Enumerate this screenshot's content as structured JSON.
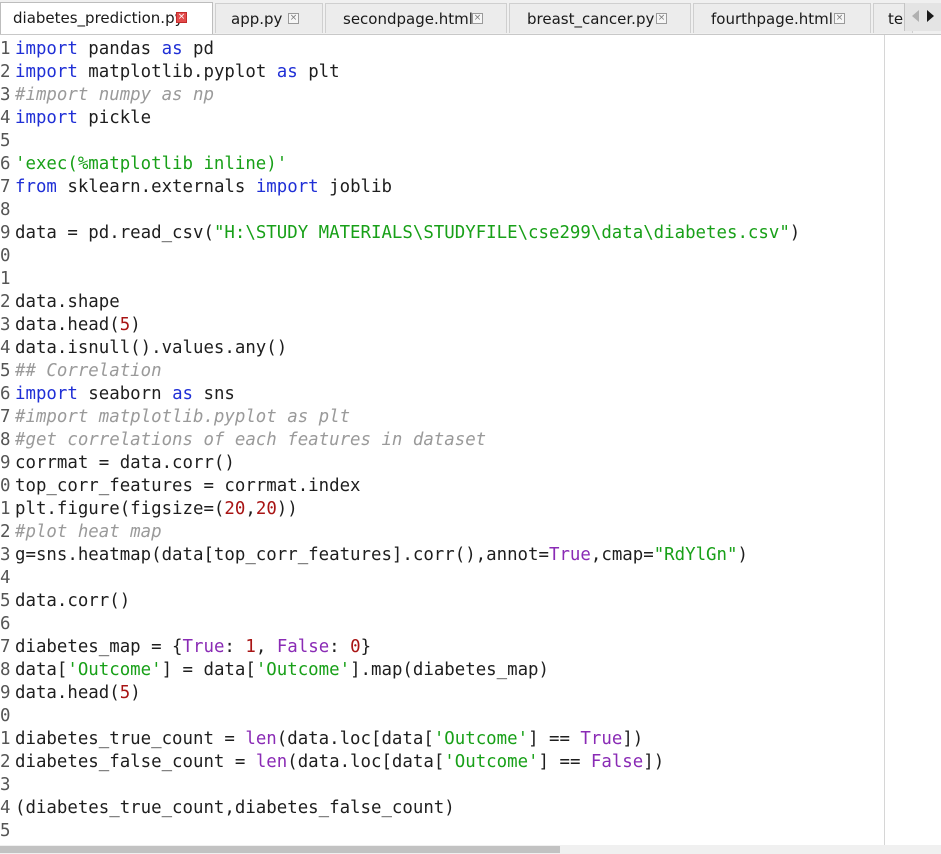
{
  "tabs": [
    {
      "label": "diabetes_prediction.py",
      "active": true
    },
    {
      "label": "app.py",
      "active": false
    },
    {
      "label": "secondpage.html",
      "active": false
    },
    {
      "label": "breast_cancer.py",
      "active": false
    },
    {
      "label": "fourthpage.html",
      "active": false
    },
    {
      "label": "te",
      "active": false
    }
  ],
  "close_glyph": "×",
  "code_lines": [
    {
      "n": "1",
      "t": [
        [
          "kw",
          "import"
        ],
        [
          "p",
          " pandas "
        ],
        [
          "kw",
          "as"
        ],
        [
          "p",
          " pd"
        ]
      ]
    },
    {
      "n": "2",
      "t": [
        [
          "kw",
          "import"
        ],
        [
          "p",
          " matplotlib.pyplot "
        ],
        [
          "kw",
          "as"
        ],
        [
          "p",
          " plt"
        ]
      ]
    },
    {
      "n": "3",
      "t": [
        [
          "cm",
          "#import numpy as np"
        ]
      ]
    },
    {
      "n": "4",
      "t": [
        [
          "kw",
          "import"
        ],
        [
          "p",
          " pickle"
        ]
      ]
    },
    {
      "n": "5",
      "t": []
    },
    {
      "n": "6",
      "t": [
        [
          "st",
          "'exec(%matplotlib inline)'"
        ]
      ]
    },
    {
      "n": "7",
      "t": [
        [
          "kw",
          "from"
        ],
        [
          "p",
          " sklearn.externals "
        ],
        [
          "kw",
          "import"
        ],
        [
          "p",
          " joblib"
        ]
      ]
    },
    {
      "n": "8",
      "t": []
    },
    {
      "n": "9",
      "t": [
        [
          "p",
          "data = pd.read_csv("
        ],
        [
          "st",
          "\"H:\\STUDY MATERIALS\\STUDYFILE\\cse299\\data\\diabetes.csv\""
        ],
        [
          "p",
          ")"
        ]
      ]
    },
    {
      "n": "0",
      "t": []
    },
    {
      "n": "1",
      "t": []
    },
    {
      "n": "2",
      "t": [
        [
          "p",
          "data.shape"
        ]
      ]
    },
    {
      "n": "3",
      "t": [
        [
          "p",
          "data.head("
        ],
        [
          "nm",
          "5"
        ],
        [
          "p",
          ")"
        ]
      ]
    },
    {
      "n": "4",
      "t": [
        [
          "p",
          "data.isnull().values.any()"
        ]
      ]
    },
    {
      "n": "5",
      "t": [
        [
          "cm",
          "## Correlation"
        ]
      ]
    },
    {
      "n": "6",
      "t": [
        [
          "kw",
          "import"
        ],
        [
          "p",
          " seaborn "
        ],
        [
          "kw",
          "as"
        ],
        [
          "p",
          " sns"
        ]
      ]
    },
    {
      "n": "7",
      "t": [
        [
          "cm",
          "#import matplotlib.pyplot as plt"
        ]
      ]
    },
    {
      "n": "8",
      "t": [
        [
          "cm",
          "#get correlations of each features in dataset"
        ]
      ]
    },
    {
      "n": "9",
      "t": [
        [
          "p",
          "corrmat = data.corr()"
        ]
      ]
    },
    {
      "n": "0",
      "t": [
        [
          "p",
          "top_corr_features = corrmat.index"
        ]
      ]
    },
    {
      "n": "1",
      "t": [
        [
          "p",
          "plt.figure(figsize=("
        ],
        [
          "nm",
          "20"
        ],
        [
          "p",
          ","
        ],
        [
          "nm",
          "20"
        ],
        [
          "p",
          "))"
        ]
      ]
    },
    {
      "n": "2",
      "t": [
        [
          "cm",
          "#plot heat map"
        ]
      ]
    },
    {
      "n": "3",
      "t": [
        [
          "p",
          "g=sns.heatmap(data[top_corr_features].corr(),annot="
        ],
        [
          "bi",
          "True"
        ],
        [
          "p",
          ",cmap="
        ],
        [
          "st",
          "\"RdYlGn\""
        ],
        [
          "p",
          ")"
        ]
      ]
    },
    {
      "n": "4",
      "t": []
    },
    {
      "n": "5",
      "t": [
        [
          "p",
          "data.corr()"
        ]
      ]
    },
    {
      "n": "6",
      "t": []
    },
    {
      "n": "7",
      "t": [
        [
          "p",
          "diabetes_map = {"
        ],
        [
          "bi",
          "True"
        ],
        [
          "p",
          ": "
        ],
        [
          "nm",
          "1"
        ],
        [
          "p",
          ", "
        ],
        [
          "bi",
          "False"
        ],
        [
          "p",
          ": "
        ],
        [
          "nm",
          "0"
        ],
        [
          "p",
          "}"
        ]
      ]
    },
    {
      "n": "8",
      "t": [
        [
          "p",
          "data["
        ],
        [
          "st",
          "'Outcome'"
        ],
        [
          "p",
          "] = data["
        ],
        [
          "st",
          "'Outcome'"
        ],
        [
          "p",
          "].map(diabetes_map)"
        ]
      ]
    },
    {
      "n": "9",
      "t": [
        [
          "p",
          "data.head("
        ],
        [
          "nm",
          "5"
        ],
        [
          "p",
          ")"
        ]
      ]
    },
    {
      "n": "0",
      "t": []
    },
    {
      "n": "1",
      "t": [
        [
          "p",
          "diabetes_true_count = "
        ],
        [
          "bi",
          "len"
        ],
        [
          "p",
          "(data.loc[data["
        ],
        [
          "st",
          "'Outcome'"
        ],
        [
          "p",
          "] == "
        ],
        [
          "bi",
          "True"
        ],
        [
          "p",
          "])"
        ]
      ]
    },
    {
      "n": "2",
      "t": [
        [
          "p",
          "diabetes_false_count = "
        ],
        [
          "bi",
          "len"
        ],
        [
          "p",
          "(data.loc[data["
        ],
        [
          "st",
          "'Outcome'"
        ],
        [
          "p",
          "] == "
        ],
        [
          "bi",
          "False"
        ],
        [
          "p",
          "])"
        ]
      ]
    },
    {
      "n": "3",
      "t": []
    },
    {
      "n": "4",
      "t": [
        [
          "p",
          "(diabetes_true_count,diabetes_false_count)"
        ]
      ]
    },
    {
      "n": "5",
      "t": []
    }
  ]
}
